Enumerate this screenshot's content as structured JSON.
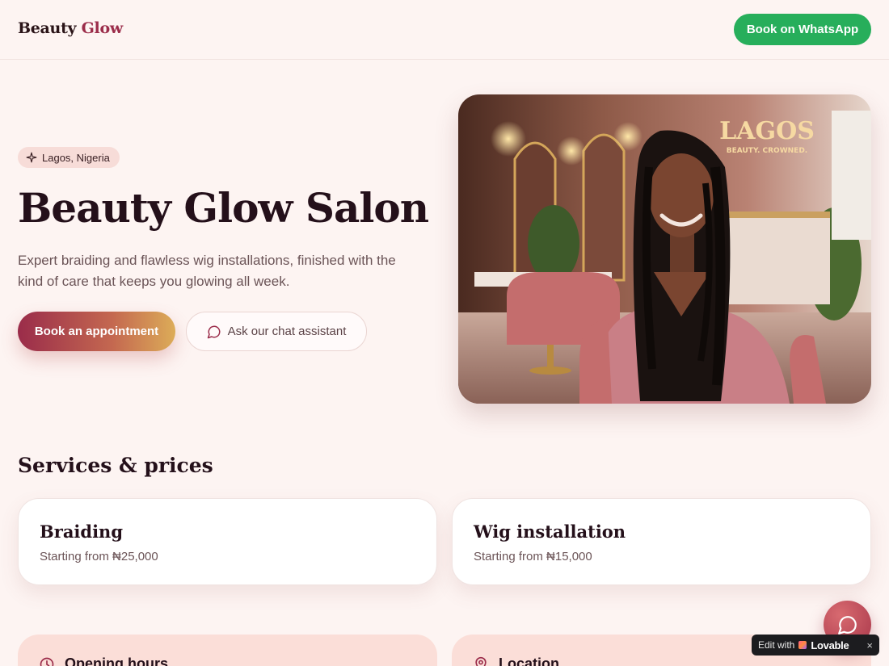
{
  "header": {
    "brand_first": "Beauty",
    "brand_second": "Glow",
    "whatsapp_label": "Book on WhatsApp"
  },
  "hero": {
    "location": "Lagos, Nigeria",
    "title": "Beauty Glow Salon",
    "description": "Expert braiding and flawless wig installations, finished with the kind of care that keeps you glowing all week.",
    "primary_cta": "Book an appointment",
    "secondary_cta": "Ask our chat assistant",
    "image_sign_title": "LAGOS",
    "image_sign_sub": "BEAUTY. CROWNED."
  },
  "services": {
    "title": "Services & prices",
    "items": [
      {
        "name": "Braiding",
        "price": "Starting from ₦25,000"
      },
      {
        "name": "Wig installation",
        "price": "Starting from ₦15,000"
      }
    ]
  },
  "info": {
    "hours_label": "Opening hours",
    "location_label": "Location"
  },
  "badge": {
    "edit_with": "Edit with",
    "brand": "Lovable",
    "close": "×"
  },
  "colors": {
    "accent": "#9b2c4a",
    "whatsapp": "#27ae5b",
    "background": "#fdf4f2",
    "info_card": "#fbded8"
  },
  "icons": {
    "pill": "sparkle-icon",
    "chat": "chat-bubble-icon",
    "hours": "clock-icon",
    "location": "map-pin-icon",
    "fab": "chat-bubble-icon"
  }
}
